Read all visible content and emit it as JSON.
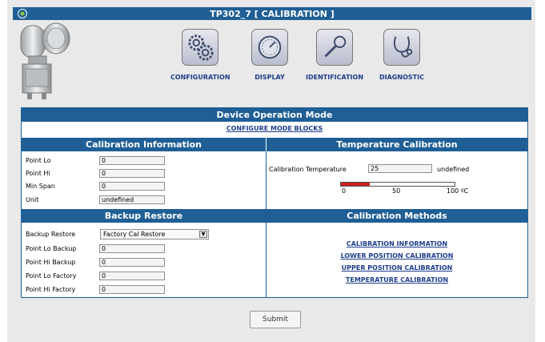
{
  "window": {
    "title": "TP302_7 [ CALIBRATION ]"
  },
  "nav": [
    {
      "label": "CONFIGURATION",
      "icon": "gears-icon"
    },
    {
      "label": "DISPLAY",
      "icon": "gauge-icon"
    },
    {
      "label": "IDENTIFICATION",
      "icon": "magnifier-icon"
    },
    {
      "label": "DIAGNOSTIC",
      "icon": "stethoscope-icon"
    }
  ],
  "device_operation": {
    "heading": "Device Operation Mode",
    "link": "CONFIGURE MODE BLOCKS"
  },
  "calibration_info": {
    "heading": "Calibration Information",
    "fields": [
      {
        "label": "Point Lo",
        "value": "0"
      },
      {
        "label": "Point Hi",
        "value": "0"
      },
      {
        "label": "Min Span",
        "value": "0"
      },
      {
        "label": "Unit",
        "value": "undefined"
      }
    ]
  },
  "temperature_calibration": {
    "heading": "Temperature Calibration",
    "label": "Calibration Temperature",
    "value": "25",
    "unit": "undefined",
    "bar": {
      "level": 25,
      "min": 0,
      "max": 100,
      "ticks": [
        "0",
        "50",
        "100 ºC"
      ]
    }
  },
  "backup_restore": {
    "heading": "Backup Restore",
    "select_label": "Backup Restore",
    "select_value": "Factory Cal Restore",
    "fields": [
      {
        "label": "Point Lo Backup",
        "value": "0"
      },
      {
        "label": "Point Hi Backup",
        "value": "0"
      },
      {
        "label": "Point Lo Factory",
        "value": "0"
      },
      {
        "label": "Point Hi Factory",
        "value": "0"
      }
    ]
  },
  "calibration_methods": {
    "heading": "Calibration Methods",
    "links": [
      "CALIBRATION INFORMATION",
      "LOWER POSITION CALIBRATION",
      "UPPER POSITION CALIBRATION",
      "TEMPERATURE CALIBRATION"
    ]
  },
  "submit_label": "Submit",
  "colors": {
    "header_blue": "#1f5f95",
    "link_blue": "#1d3d8a",
    "bar_red": "#cc1e1e"
  }
}
